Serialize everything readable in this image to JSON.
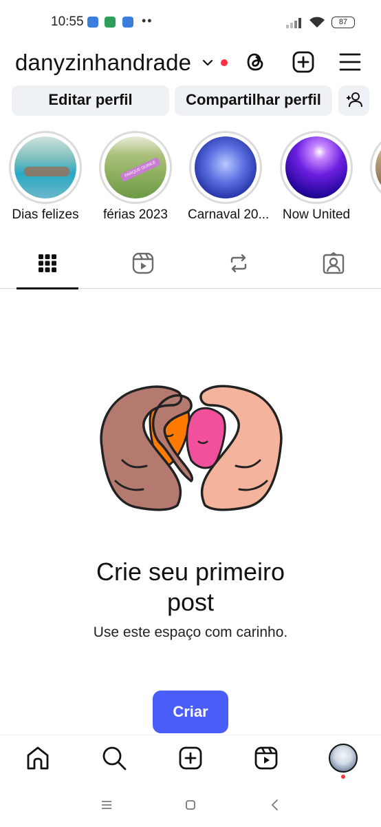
{
  "status_bar": {
    "time": "10:55",
    "battery": "87",
    "dots": "••"
  },
  "header": {
    "username": "danyzinhandrade"
  },
  "profile_actions": {
    "edit_label": "Editar perfil",
    "share_label": "Compartilhar perfil"
  },
  "highlights": [
    {
      "label": "Dias felizes"
    },
    {
      "label": "férias 2023"
    },
    {
      "label": "Carnaval 20..."
    },
    {
      "label": "Now United"
    }
  ],
  "tabs": [
    "grid-icon",
    "reels-icon",
    "reposts-icon",
    "tagged-icon"
  ],
  "empty_state": {
    "title_line1": "Crie seu primeiro",
    "title_line2": "post",
    "subtitle": "Use este espaço com carinho.",
    "button_label": "Criar"
  },
  "highlight_sticker": "PARQUE GUINLE",
  "colors": {
    "accent": "#4a5df9",
    "notification": "#ff3040",
    "pill_bg": "#eff2f5"
  }
}
